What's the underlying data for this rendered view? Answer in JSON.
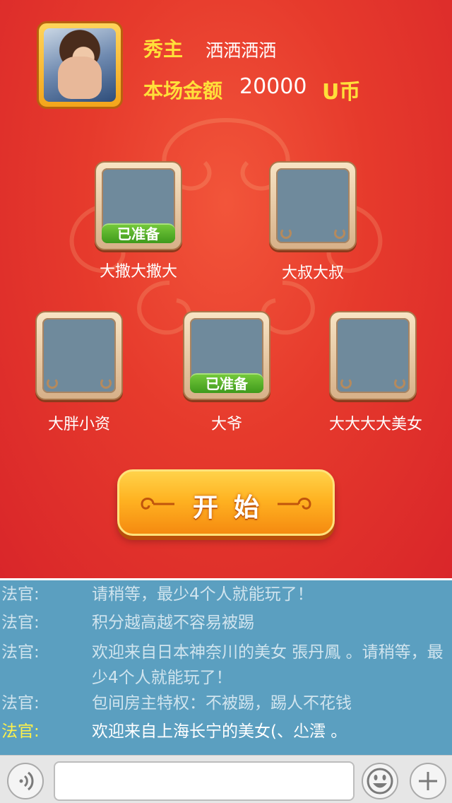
{
  "host": {
    "title": "秀主",
    "name": "洒洒洒洒",
    "amount_label": "本场金额",
    "amount_value": "20000",
    "amount_unit": "U币"
  },
  "slots": [
    {
      "name": "大撒大撒大",
      "ready": true,
      "ready_label": "已准备"
    },
    {
      "name": "大叔大叔",
      "ready": false
    },
    {
      "name": "大胖小资",
      "ready": false
    },
    {
      "name": "大爷",
      "ready": true,
      "ready_label": "已准备"
    },
    {
      "name": "大大大大美女",
      "ready": false
    }
  ],
  "start_button": {
    "label": "开始"
  },
  "chat": {
    "messages": [
      {
        "speaker": "法官:",
        "text": "请稍等，最少4个人就能玩了！"
      },
      {
        "speaker": "法官:",
        "text": "积分越高越不容易被踢"
      },
      {
        "speaker": "法官:",
        "text": "欢迎来自日本神奈川的美女 張丹鳳 。请稍等，最少4个人就能玩了！"
      },
      {
        "speaker": "法官:",
        "text": "包间房主特权：不被踢，踢人不花钱"
      },
      {
        "speaker": "法官:",
        "text": "欢迎来自上海长宁的美女(、尐澐 。"
      }
    ]
  },
  "input_bar": {
    "voice_icon": "voice-icon",
    "emoji_icon": "smiley-icon",
    "add_icon": "plus-icon",
    "input_value": ""
  },
  "colors": {
    "background_red": "#e63a2c",
    "gold_text": "#ffdf3a",
    "ready_green": "#4fae24",
    "start_orange": "#ffb322",
    "chat_blue": "#5b9fc0",
    "latest_speaker": "#fff14a"
  }
}
